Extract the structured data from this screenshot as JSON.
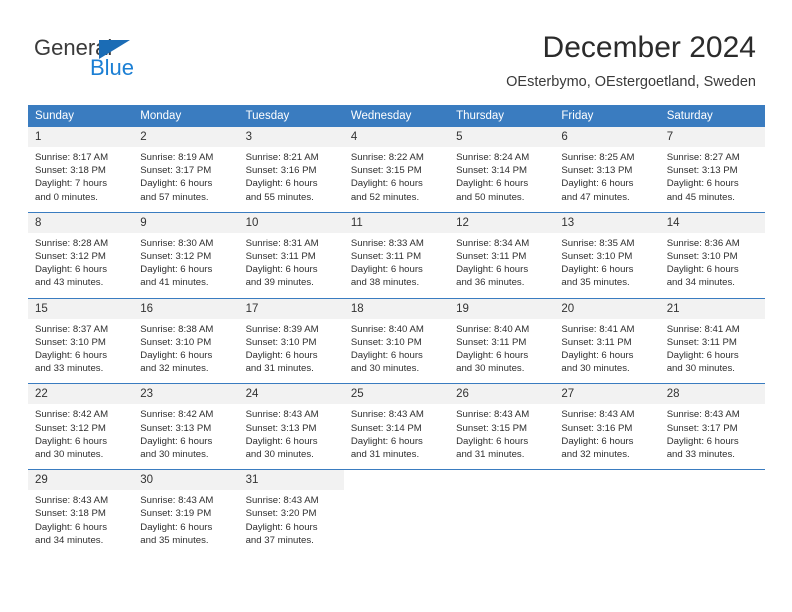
{
  "brand": {
    "name_part1": "General",
    "name_part2": "Blue",
    "triangle_icon": "triangle-icon",
    "accent_color": "#1b7fd4",
    "triangle_color": "#1b6cb5"
  },
  "header": {
    "title": "December 2024",
    "subtitle": "OEsterbymo, OEstergoetland, Sweden"
  },
  "calendar": {
    "header_bg": "#3a7cc0",
    "daynum_bg": "#f2f2f2",
    "weekday_headers": [
      "Sunday",
      "Monday",
      "Tuesday",
      "Wednesday",
      "Thursday",
      "Friday",
      "Saturday"
    ],
    "weeks": [
      [
        {
          "day": "1",
          "sunrise": "Sunrise: 8:17 AM",
          "sunset": "Sunset: 3:18 PM",
          "daylight_line1": "Daylight: 7 hours",
          "daylight_line2": "and 0 minutes."
        },
        {
          "day": "2",
          "sunrise": "Sunrise: 8:19 AM",
          "sunset": "Sunset: 3:17 PM",
          "daylight_line1": "Daylight: 6 hours",
          "daylight_line2": "and 57 minutes."
        },
        {
          "day": "3",
          "sunrise": "Sunrise: 8:21 AM",
          "sunset": "Sunset: 3:16 PM",
          "daylight_line1": "Daylight: 6 hours",
          "daylight_line2": "and 55 minutes."
        },
        {
          "day": "4",
          "sunrise": "Sunrise: 8:22 AM",
          "sunset": "Sunset: 3:15 PM",
          "daylight_line1": "Daylight: 6 hours",
          "daylight_line2": "and 52 minutes."
        },
        {
          "day": "5",
          "sunrise": "Sunrise: 8:24 AM",
          "sunset": "Sunset: 3:14 PM",
          "daylight_line1": "Daylight: 6 hours",
          "daylight_line2": "and 50 minutes."
        },
        {
          "day": "6",
          "sunrise": "Sunrise: 8:25 AM",
          "sunset": "Sunset: 3:13 PM",
          "daylight_line1": "Daylight: 6 hours",
          "daylight_line2": "and 47 minutes."
        },
        {
          "day": "7",
          "sunrise": "Sunrise: 8:27 AM",
          "sunset": "Sunset: 3:13 PM",
          "daylight_line1": "Daylight: 6 hours",
          "daylight_line2": "and 45 minutes."
        }
      ],
      [
        {
          "day": "8",
          "sunrise": "Sunrise: 8:28 AM",
          "sunset": "Sunset: 3:12 PM",
          "daylight_line1": "Daylight: 6 hours",
          "daylight_line2": "and 43 minutes."
        },
        {
          "day": "9",
          "sunrise": "Sunrise: 8:30 AM",
          "sunset": "Sunset: 3:12 PM",
          "daylight_line1": "Daylight: 6 hours",
          "daylight_line2": "and 41 minutes."
        },
        {
          "day": "10",
          "sunrise": "Sunrise: 8:31 AM",
          "sunset": "Sunset: 3:11 PM",
          "daylight_line1": "Daylight: 6 hours",
          "daylight_line2": "and 39 minutes."
        },
        {
          "day": "11",
          "sunrise": "Sunrise: 8:33 AM",
          "sunset": "Sunset: 3:11 PM",
          "daylight_line1": "Daylight: 6 hours",
          "daylight_line2": "and 38 minutes."
        },
        {
          "day": "12",
          "sunrise": "Sunrise: 8:34 AM",
          "sunset": "Sunset: 3:11 PM",
          "daylight_line1": "Daylight: 6 hours",
          "daylight_line2": "and 36 minutes."
        },
        {
          "day": "13",
          "sunrise": "Sunrise: 8:35 AM",
          "sunset": "Sunset: 3:10 PM",
          "daylight_line1": "Daylight: 6 hours",
          "daylight_line2": "and 35 minutes."
        },
        {
          "day": "14",
          "sunrise": "Sunrise: 8:36 AM",
          "sunset": "Sunset: 3:10 PM",
          "daylight_line1": "Daylight: 6 hours",
          "daylight_line2": "and 34 minutes."
        }
      ],
      [
        {
          "day": "15",
          "sunrise": "Sunrise: 8:37 AM",
          "sunset": "Sunset: 3:10 PM",
          "daylight_line1": "Daylight: 6 hours",
          "daylight_line2": "and 33 minutes."
        },
        {
          "day": "16",
          "sunrise": "Sunrise: 8:38 AM",
          "sunset": "Sunset: 3:10 PM",
          "daylight_line1": "Daylight: 6 hours",
          "daylight_line2": "and 32 minutes."
        },
        {
          "day": "17",
          "sunrise": "Sunrise: 8:39 AM",
          "sunset": "Sunset: 3:10 PM",
          "daylight_line1": "Daylight: 6 hours",
          "daylight_line2": "and 31 minutes."
        },
        {
          "day": "18",
          "sunrise": "Sunrise: 8:40 AM",
          "sunset": "Sunset: 3:10 PM",
          "daylight_line1": "Daylight: 6 hours",
          "daylight_line2": "and 30 minutes."
        },
        {
          "day": "19",
          "sunrise": "Sunrise: 8:40 AM",
          "sunset": "Sunset: 3:11 PM",
          "daylight_line1": "Daylight: 6 hours",
          "daylight_line2": "and 30 minutes."
        },
        {
          "day": "20",
          "sunrise": "Sunrise: 8:41 AM",
          "sunset": "Sunset: 3:11 PM",
          "daylight_line1": "Daylight: 6 hours",
          "daylight_line2": "and 30 minutes."
        },
        {
          "day": "21",
          "sunrise": "Sunrise: 8:41 AM",
          "sunset": "Sunset: 3:11 PM",
          "daylight_line1": "Daylight: 6 hours",
          "daylight_line2": "and 30 minutes."
        }
      ],
      [
        {
          "day": "22",
          "sunrise": "Sunrise: 8:42 AM",
          "sunset": "Sunset: 3:12 PM",
          "daylight_line1": "Daylight: 6 hours",
          "daylight_line2": "and 30 minutes."
        },
        {
          "day": "23",
          "sunrise": "Sunrise: 8:42 AM",
          "sunset": "Sunset: 3:13 PM",
          "daylight_line1": "Daylight: 6 hours",
          "daylight_line2": "and 30 minutes."
        },
        {
          "day": "24",
          "sunrise": "Sunrise: 8:43 AM",
          "sunset": "Sunset: 3:13 PM",
          "daylight_line1": "Daylight: 6 hours",
          "daylight_line2": "and 30 minutes."
        },
        {
          "day": "25",
          "sunrise": "Sunrise: 8:43 AM",
          "sunset": "Sunset: 3:14 PM",
          "daylight_line1": "Daylight: 6 hours",
          "daylight_line2": "and 31 minutes."
        },
        {
          "day": "26",
          "sunrise": "Sunrise: 8:43 AM",
          "sunset": "Sunset: 3:15 PM",
          "daylight_line1": "Daylight: 6 hours",
          "daylight_line2": "and 31 minutes."
        },
        {
          "day": "27",
          "sunrise": "Sunrise: 8:43 AM",
          "sunset": "Sunset: 3:16 PM",
          "daylight_line1": "Daylight: 6 hours",
          "daylight_line2": "and 32 minutes."
        },
        {
          "day": "28",
          "sunrise": "Sunrise: 8:43 AM",
          "sunset": "Sunset: 3:17 PM",
          "daylight_line1": "Daylight: 6 hours",
          "daylight_line2": "and 33 minutes."
        }
      ],
      [
        {
          "day": "29",
          "sunrise": "Sunrise: 8:43 AM",
          "sunset": "Sunset: 3:18 PM",
          "daylight_line1": "Daylight: 6 hours",
          "daylight_line2": "and 34 minutes."
        },
        {
          "day": "30",
          "sunrise": "Sunrise: 8:43 AM",
          "sunset": "Sunset: 3:19 PM",
          "daylight_line1": "Daylight: 6 hours",
          "daylight_line2": "and 35 minutes."
        },
        {
          "day": "31",
          "sunrise": "Sunrise: 8:43 AM",
          "sunset": "Sunset: 3:20 PM",
          "daylight_line1": "Daylight: 6 hours",
          "daylight_line2": "and 37 minutes."
        },
        {
          "day": "",
          "sunrise": "",
          "sunset": "",
          "daylight_line1": "",
          "daylight_line2": ""
        },
        {
          "day": "",
          "sunrise": "",
          "sunset": "",
          "daylight_line1": "",
          "daylight_line2": ""
        },
        {
          "day": "",
          "sunrise": "",
          "sunset": "",
          "daylight_line1": "",
          "daylight_line2": ""
        },
        {
          "day": "",
          "sunrise": "",
          "sunset": "",
          "daylight_line1": "",
          "daylight_line2": ""
        }
      ]
    ]
  }
}
